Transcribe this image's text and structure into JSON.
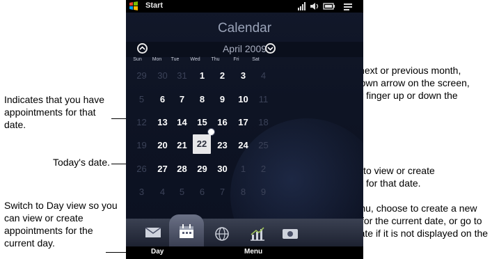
{
  "status_bar": {
    "start_label": "Start"
  },
  "calendar": {
    "title": "Calendar",
    "month": "April 2009",
    "weekdays": [
      "Sun",
      "Mon",
      "Tue",
      "Wed",
      "Thu",
      "Fri",
      "Sat"
    ],
    "weeks": [
      [
        "29",
        "30",
        "31",
        "1",
        "2",
        "3",
        "4"
      ],
      [
        "5",
        "6",
        "7",
        "8",
        "9",
        "10",
        "11"
      ],
      [
        "12",
        "13",
        "14",
        "15",
        "16",
        "17",
        "18"
      ],
      [
        "19",
        "20",
        "21",
        "22",
        "23",
        "24",
        "25"
      ],
      [
        "26",
        "27",
        "28",
        "29",
        "30",
        "1",
        "2"
      ],
      [
        "3",
        "4",
        "5",
        "6",
        "7",
        "8",
        "9"
      ]
    ],
    "today": "22"
  },
  "softkeys": {
    "left": "Day",
    "right": "Menu"
  },
  "annotations": {
    "nav": "To go to the next or previous month, tap the Up/Down arrow on the screen, or swipe your finger up or down the screen.",
    "appt": "Indicates that you have appointments for that date.",
    "today": "Today's date.",
    "touch": "Touch a date to view or create appointments for that date.",
    "day_view": "Switch to Day view so you can view or create appointments for the current day.",
    "menu": "From the menu, choose to create a new appointment for the current date, or go to the current date if it is not displayed on the screen."
  },
  "colors": {
    "accent": "#0e1424",
    "today_bg": "#e8e8ea",
    "tab_bar": "#2a3040"
  },
  "icons": [
    "windows-logo-icon",
    "signal-icon",
    "volume-icon",
    "battery-icon",
    "menu-icon",
    "arrow-up-icon",
    "arrow-down-icon",
    "mail-icon",
    "calendar-icon",
    "globe-icon",
    "chart-icon",
    "camera-icon"
  ]
}
